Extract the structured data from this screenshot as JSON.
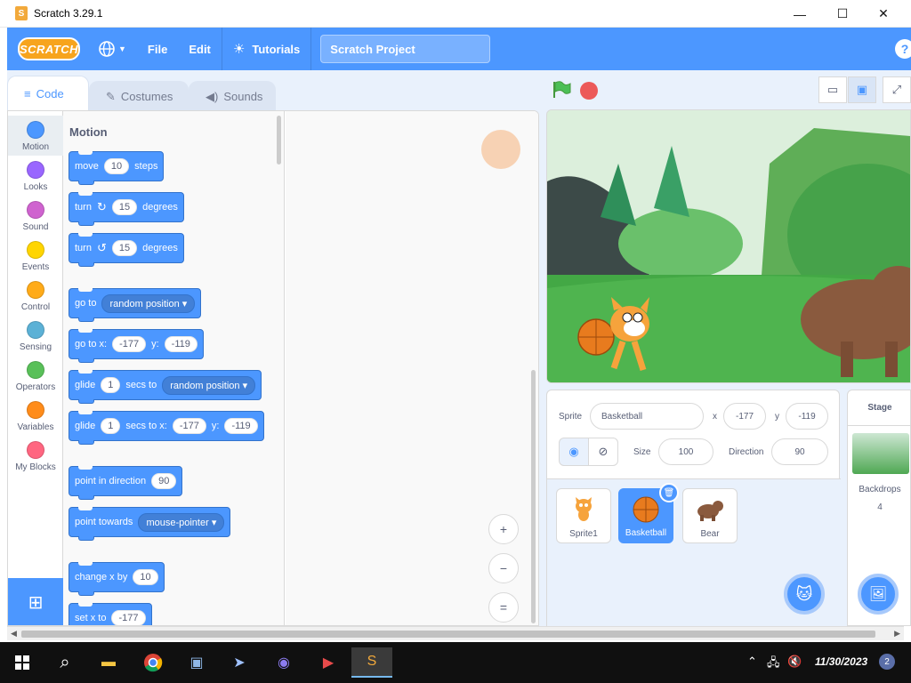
{
  "window": {
    "title": "Scratch 3.29.1",
    "minimize": "—",
    "maximize": "☐",
    "close": "✕"
  },
  "menubar": {
    "logo": "SCRATCH",
    "language_icon": "globe-icon",
    "file": "File",
    "edit": "Edit",
    "tutorials": "Tutorials",
    "project_title": "Scratch Project",
    "help": "?"
  },
  "tabs": [
    {
      "label": "Code",
      "icon": "code-icon",
      "active": true
    },
    {
      "label": "Costumes",
      "icon": "brush-icon",
      "active": false
    },
    {
      "label": "Sounds",
      "icon": "speaker-icon",
      "active": false
    }
  ],
  "categories": [
    {
      "label": "Motion",
      "color": "#4c97ff"
    },
    {
      "label": "Looks",
      "color": "#9966ff"
    },
    {
      "label": "Sound",
      "color": "#cf63cf"
    },
    {
      "label": "Events",
      "color": "#ffd500"
    },
    {
      "label": "Control",
      "color": "#ffab19"
    },
    {
      "label": "Sensing",
      "color": "#5cb1d6"
    },
    {
      "label": "Operators",
      "color": "#59c059"
    },
    {
      "label": "Variables",
      "color": "#ff8c1a"
    },
    {
      "label": "My Blocks",
      "color": "#ff6680"
    }
  ],
  "palette": {
    "title": "Motion",
    "move": {
      "a": "move",
      "n": "10",
      "b": "steps"
    },
    "turn_cw": {
      "a": "turn",
      "n": "15",
      "b": "degrees"
    },
    "turn_ccw": {
      "a": "turn",
      "n": "15",
      "b": "degrees"
    },
    "goto": {
      "a": "go to",
      "dd": "random position"
    },
    "goto_xy": {
      "a": "go to x:",
      "x": "-177",
      "b": "y:",
      "y": "-119"
    },
    "glide_to": {
      "a": "glide",
      "n": "1",
      "b": "secs to",
      "dd": "random position"
    },
    "glide_xy": {
      "a": "glide",
      "n": "1",
      "b": "secs to x:",
      "x": "-177",
      "c": "y:",
      "y": "-119"
    },
    "point_dir": {
      "a": "point in direction",
      "n": "90"
    },
    "point_towards": {
      "a": "point towards",
      "dd": "mouse-pointer"
    },
    "change_x": {
      "a": "change x by",
      "n": "10"
    },
    "set_x": {
      "a": "set x to",
      "n": "-177"
    }
  },
  "zoom": {
    "in": "+",
    "out": "−",
    "reset": "="
  },
  "sprite_info": {
    "sprite_label": "Sprite",
    "sprite_name": "Basketball",
    "x_label": "x",
    "x": "-177",
    "y_label": "y",
    "y": "-119",
    "size_label": "Size",
    "size": "100",
    "direction_label": "Direction",
    "direction": "90"
  },
  "sprites": [
    {
      "name": "Sprite1",
      "selected": false
    },
    {
      "name": "Basketball",
      "selected": true
    },
    {
      "name": "Bear",
      "selected": false
    }
  ],
  "stage_pane": {
    "header": "Stage",
    "backdrops_label": "Backdrops",
    "backdrops_count": "4"
  },
  "taskbar": {
    "time": "11/30/2023",
    "notifications": "2"
  }
}
